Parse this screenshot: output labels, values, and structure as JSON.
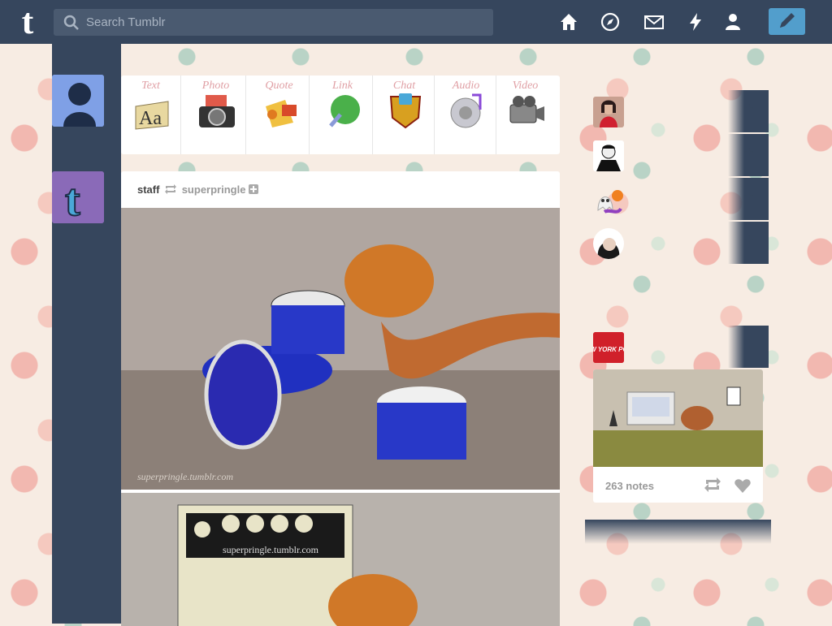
{
  "header": {
    "logo": "t",
    "search_placeholder": "Search Tumblr",
    "nav": [
      "home-icon",
      "explore-icon",
      "inbox-icon",
      "activity-icon",
      "account-icon"
    ],
    "colors": {
      "header_bg": "#36465d",
      "compose_bg": "#529ecc"
    }
  },
  "post_types": [
    {
      "label": "Text",
      "icon": "text-icon"
    },
    {
      "label": "Photo",
      "icon": "photo-icon"
    },
    {
      "label": "Quote",
      "icon": "quote-icon"
    },
    {
      "label": "Link",
      "icon": "link-icon"
    },
    {
      "label": "Chat",
      "icon": "chat-icon"
    },
    {
      "label": "Audio",
      "icon": "audio-icon"
    },
    {
      "label": "Video",
      "icon": "video-icon"
    }
  ],
  "post": {
    "author": "staff",
    "reblogged_from": "superpringle",
    "watermark1": "superpringle.tumblr.com",
    "watermark2": "superpringle.tumblr.com"
  },
  "recommended": [
    {
      "name": "avatar-woman"
    },
    {
      "name": "avatar-man-suit"
    },
    {
      "name": "avatar-ghost"
    },
    {
      "name": "avatar-woman-2"
    }
  ],
  "radar": {
    "avatar_text": "NEW YORK POST",
    "notes": "263 notes"
  }
}
